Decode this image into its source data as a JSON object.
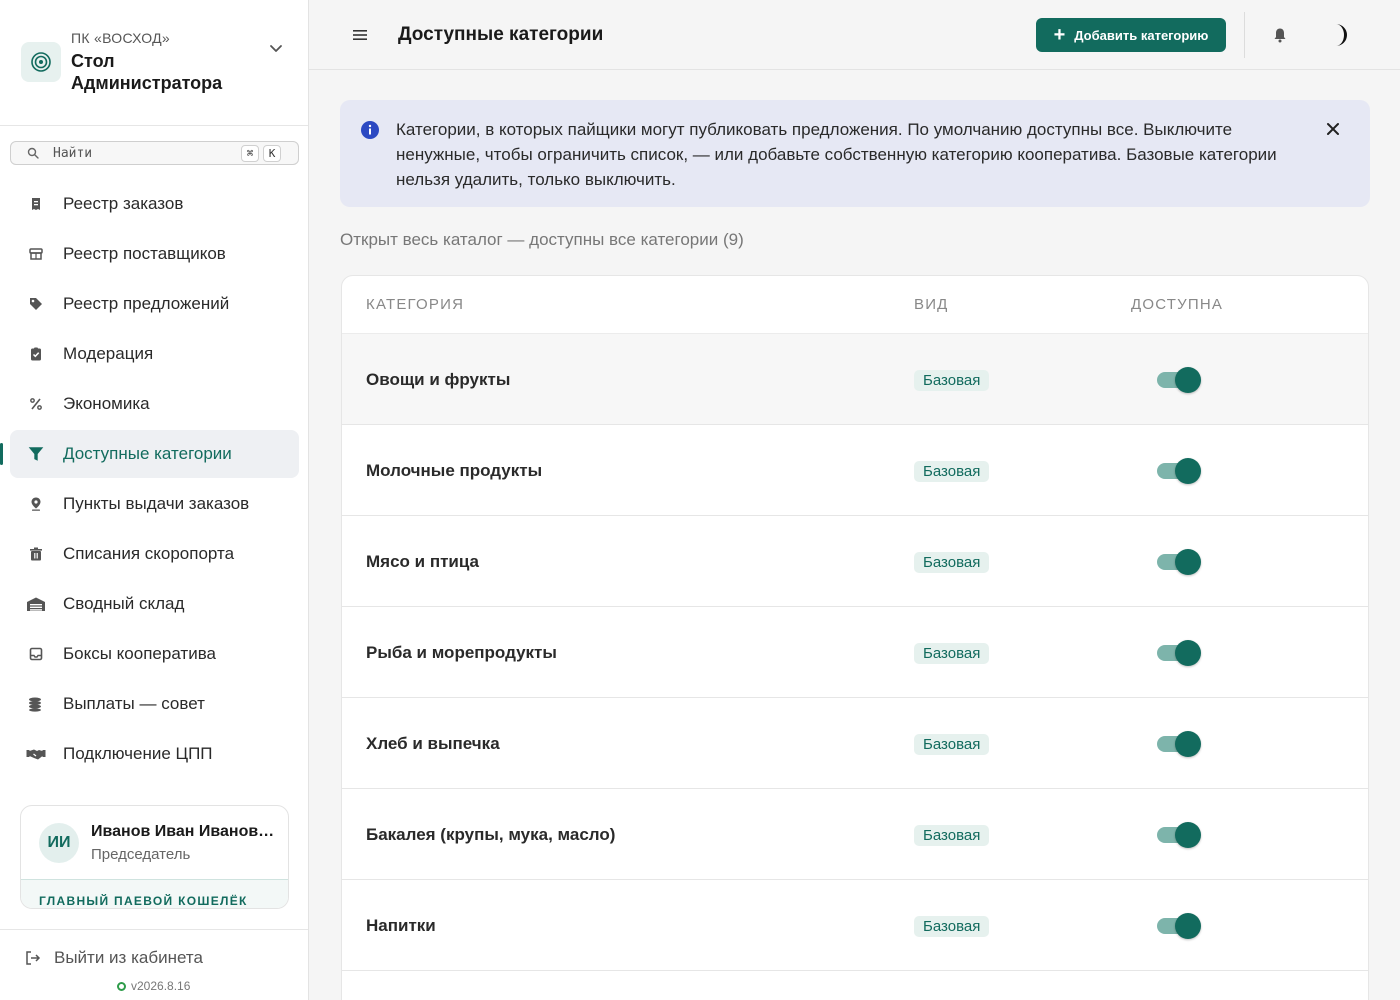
{
  "brand": {
    "org": "ПК «ВОСХОД»",
    "title": "Стол Администратора"
  },
  "search": {
    "placeholder": "Найти",
    "shortcut_mod": "⌘",
    "shortcut_key": "K"
  },
  "sidebar": {
    "items": [
      {
        "label": "Реестр заказов",
        "icon": "receipt-icon"
      },
      {
        "label": "Реестр поставщиков",
        "icon": "store-icon"
      },
      {
        "label": "Реестр предложений",
        "icon": "tag-icon"
      },
      {
        "label": "Модерация",
        "icon": "clipboard-check-icon"
      },
      {
        "label": "Экономика",
        "icon": "percent-icon"
      },
      {
        "label": "Доступные категории",
        "icon": "filter-icon",
        "active": true
      },
      {
        "label": "Пункты выдачи заказов",
        "icon": "map-pin-icon"
      },
      {
        "label": "Списания скоропорта",
        "icon": "trash-box-icon"
      },
      {
        "label": "Сводный склад",
        "icon": "warehouse-icon"
      },
      {
        "label": "Боксы кооператива",
        "icon": "inbox-icon"
      },
      {
        "label": "Выплаты — совет",
        "icon": "coins-icon"
      },
      {
        "label": "Подключение ЦПП",
        "icon": "handshake-icon"
      }
    ]
  },
  "user": {
    "initials": "ИИ",
    "name": "Иванов Иван Иванович",
    "role": "Председатель",
    "wallet_label": "ГЛАВНЫЙ ПАЕВОЙ КОШЕЛЁК"
  },
  "footer": {
    "logout_label": "Выйти из кабинета",
    "version": "v2026.8.16"
  },
  "header": {
    "title": "Доступные категории",
    "add_button_label": "Добавить категорию"
  },
  "info": {
    "text": "Категории, в которых пайщики могут публиковать предложения. По умолчанию доступны все. Выключите ненужные, чтобы ограничить список, — или добавьте собственную категорию кооператива. Базовые категории нельзя удалить, только выключить."
  },
  "summary": "Открыт весь каталог — доступны все категории (9)",
  "table": {
    "columns": [
      "КАТЕГОРИЯ",
      "ВИД",
      "ДОСТУПНА"
    ],
    "rows": [
      {
        "name": "Овощи и фрукты",
        "kind": "Базовая",
        "enabled": true
      },
      {
        "name": "Молочные продукты",
        "kind": "Базовая",
        "enabled": true
      },
      {
        "name": "Мясо и птица",
        "kind": "Базовая",
        "enabled": true
      },
      {
        "name": "Рыба и морепродукты",
        "kind": "Базовая",
        "enabled": true
      },
      {
        "name": "Хлеб и выпечка",
        "kind": "Базовая",
        "enabled": true
      },
      {
        "name": "Бакалея (крупы, мука, масло)",
        "kind": "Базовая",
        "enabled": true
      },
      {
        "name": "Напитки",
        "kind": "Базовая",
        "enabled": true
      }
    ]
  },
  "colors": {
    "accent": "#126b5e",
    "info_bg": "#e6e8f4",
    "badge_bg": "#e6f1ee",
    "toggle_track": "#7db4ab"
  }
}
